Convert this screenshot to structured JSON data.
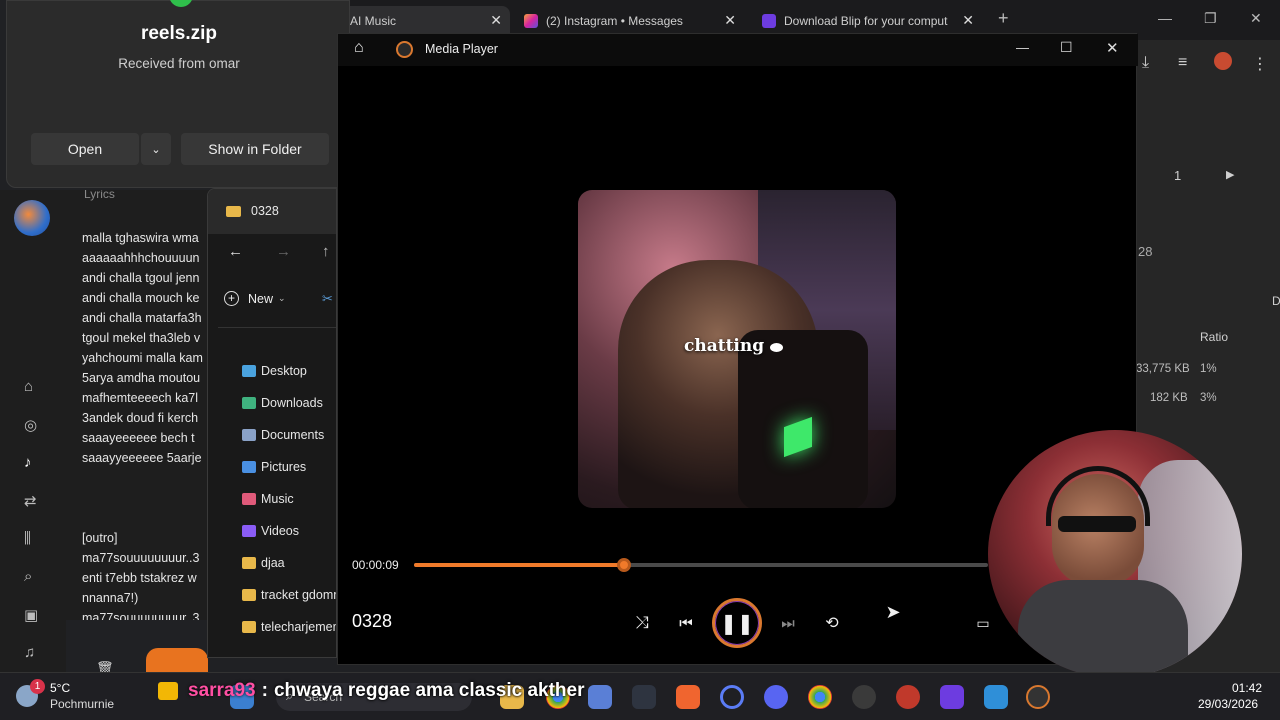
{
  "browser": {
    "tabs": [
      {
        "label": "AI Music",
        "color": "#2e2e30"
      },
      {
        "label": "(2) Instagram • Messages",
        "color": "#1b1b1d"
      },
      {
        "label": "Download Blip for your comput",
        "color": "#1b1b1d"
      }
    ],
    "page_number": "1",
    "right_fragments": [
      "28",
      "D",
      "Ratio",
      "33,775 KB",
      "1%",
      "182 KB",
      "3%"
    ]
  },
  "download_popup": {
    "filename": "reels.zip",
    "subtitle": "Received from omar",
    "open_label": "Open",
    "show_label": "Show in Folder"
  },
  "music": {
    "lyrics_header": "Lyrics",
    "lines": [
      "malla tghaswira wma",
      "aaaaaahhhchouuuun",
      "andi challa tgoul jenn",
      "andi challa mouch ke",
      "andi challa matarfa3h",
      "tgoul mekel tha3leb v",
      "yahchoumi malla kam",
      "5arya amdha moutou",
      "mafhemteeeech ka7l",
      "3andek doud fi kerch",
      "saaayeeeeee bech t",
      "saaayyeeeeee 5aarje",
      "",
      "",
      "[outro]",
      "ma77souuuuuuuur..3",
      "enti t7ebb tstakrez w",
      "nnanna7!)",
      "ma77souuuuuuuur..3"
    ]
  },
  "explorer": {
    "title": "0328",
    "new_label": "New",
    "items": [
      {
        "label": "Desktop",
        "color": "#4aa3df"
      },
      {
        "label": "Downloads",
        "color": "#3fb27f"
      },
      {
        "label": "Documents",
        "color": "#8aa2c8"
      },
      {
        "label": "Pictures",
        "color": "#4a90e2"
      },
      {
        "label": "Music",
        "color": "#e05a7a"
      },
      {
        "label": "Videos",
        "color": "#8a5cf6"
      },
      {
        "label": "djaa",
        "color": "#e8b84a"
      },
      {
        "label": "tracket gdomm",
        "color": "#e8b84a"
      },
      {
        "label": "telecharjement",
        "color": "#e8b84a"
      }
    ]
  },
  "player": {
    "app_title": "Media Player",
    "current_time": "00:00:09",
    "track_title": "0328",
    "progress": 0.365,
    "video_caption": "chatting",
    "accent": "#f07a2a"
  },
  "taskbar": {
    "weather_temp": "5°C",
    "weather_desc": "Pochmurnie",
    "weather_badge": "1",
    "clock_time": "01:42",
    "clock_date": "29/03/2026",
    "search_label": "Search",
    "chat_user": "sarra93",
    "chat_text": "chwaya reggae ama classic akther"
  }
}
